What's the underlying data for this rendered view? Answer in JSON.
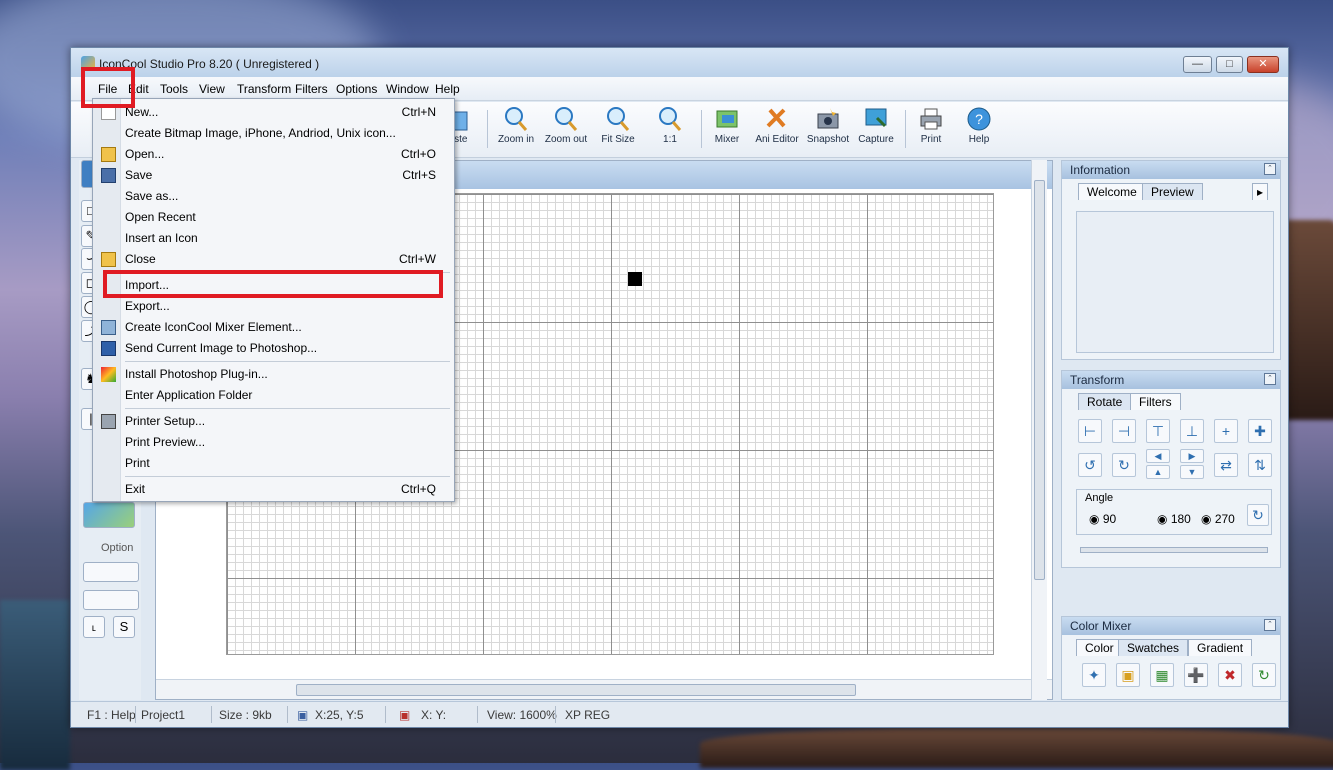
{
  "window": {
    "title": "IconCool Studio Pro 8.20 ( Unregistered )",
    "controls": [
      "—",
      "□",
      "✕"
    ]
  },
  "menubar": [
    "File",
    "Edit",
    "Tools",
    "View",
    "Transform",
    "Filters",
    "Options",
    "Window",
    "Help"
  ],
  "toolbar": {
    "partial_label": "aste",
    "buttons": [
      "Zoom in",
      "Zoom out",
      "Fit Size",
      "1:1",
      "Mixer",
      "Ani Editor",
      "Snapshot",
      "Capture",
      "Print",
      "Help"
    ]
  },
  "file_menu": {
    "items": [
      {
        "label": "New...",
        "shortcut": "Ctrl+N"
      },
      {
        "label": "Create Bitmap Image, iPhone, Andriod, Unix icon...",
        "shortcut": ""
      },
      {
        "label": "Open...",
        "shortcut": "Ctrl+O"
      },
      {
        "label": "Save",
        "shortcut": "Ctrl+S"
      },
      {
        "label": "Save as...",
        "shortcut": ""
      },
      {
        "label": "Open Recent",
        "shortcut": ""
      },
      {
        "label": "Insert an Icon",
        "shortcut": ""
      },
      {
        "label": "Close",
        "shortcut": "Ctrl+W"
      },
      {
        "label": "Import...",
        "shortcut": ""
      },
      {
        "label": "Export...",
        "shortcut": ""
      },
      {
        "label": "Create IconCool Mixer Element...",
        "shortcut": ""
      },
      {
        "label": "Send Current Image to Photoshop...",
        "shortcut": ""
      },
      {
        "label": "Install Photoshop Plug-in...",
        "shortcut": ""
      },
      {
        "label": "Enter Application Folder",
        "shortcut": ""
      },
      {
        "label": "Printer Setup...",
        "shortcut": ""
      },
      {
        "label": "Print Preview...",
        "shortcut": ""
      },
      {
        "label": "Print",
        "shortcut": ""
      },
      {
        "label": "Exit",
        "shortcut": "Ctrl+Q"
      }
    ]
  },
  "left_tools": {
    "option_label": "Option",
    "s_label": "S",
    "corner_label": "˪"
  },
  "information_panel": {
    "title": "Information",
    "tabs": [
      "Welcome",
      "Preview"
    ]
  },
  "transform_panel": {
    "title": "Transform",
    "tabs": [
      "Rotate",
      "Filters"
    ],
    "angle_label": "Angle",
    "angles": [
      "90",
      "180",
      "270"
    ]
  },
  "color_mixer_panel": {
    "title": "Color Mixer",
    "tabs": [
      "Color",
      "Swatches",
      "Gradient"
    ]
  },
  "statusbar": {
    "help": "F1 : Help",
    "project": "Project1",
    "size": "Size : 9kb",
    "cursor": "X:25, Y:5",
    "selection": "X: Y:",
    "view": "View: 1600%",
    "theme": "XP REG"
  },
  "colors": {
    "highlight": "#e01b23",
    "titlebar": "#bcd2ea",
    "menu_bg": "#f4f6f9"
  }
}
